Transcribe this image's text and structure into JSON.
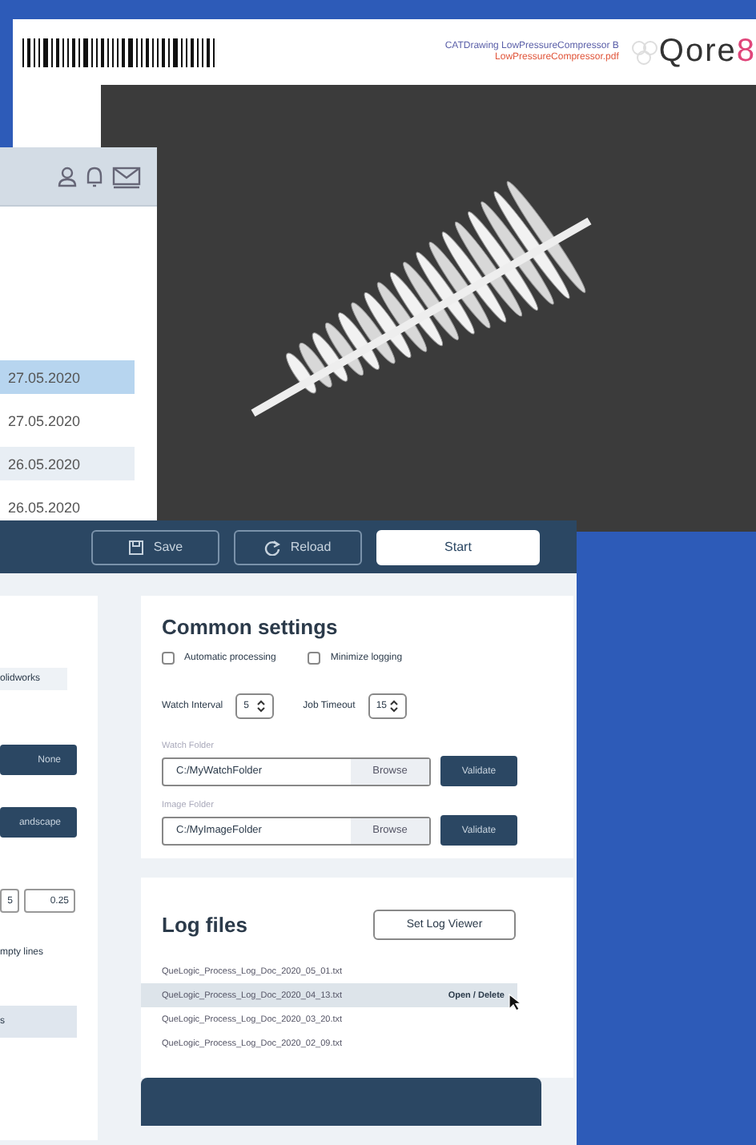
{
  "document_window": {
    "file_title": "CATDrawing LowPressureCompressor B",
    "file_name": "LowPressureCompressor.pdf",
    "logo_word": "Qore",
    "logo_digit": "8"
  },
  "list_window": {
    "rows": [
      {
        "date": "27.05.2020",
        "selected": true,
        "hovered": false
      },
      {
        "date": "27.05.2020",
        "selected": false,
        "hovered": false
      },
      {
        "date": "26.05.2020",
        "selected": false,
        "hovered": true
      },
      {
        "date": "26.05.2020",
        "selected": false,
        "hovered": false
      }
    ]
  },
  "settings_window": {
    "toolbar": [
      {
        "label": "Save",
        "kind": "outline"
      },
      {
        "label": "Reload",
        "kind": "outline"
      },
      {
        "label": "Start",
        "kind": "primary"
      }
    ],
    "left_panel": [
      {
        "kind": "chip",
        "text": "olidworks"
      },
      {
        "kind": "button",
        "text": "None"
      },
      {
        "kind": "button",
        "text": "andscape"
      },
      {
        "kind": "inputs",
        "values": [
          "5",
          "0.25"
        ]
      },
      {
        "kind": "text",
        "text": "mpty lines"
      },
      {
        "kind": "bar",
        "text": "s"
      }
    ],
    "common_settings": {
      "title": "Common settings",
      "checkboxes": [
        {
          "label": "Automatic processing",
          "checked": false
        },
        {
          "label": "Minimize logging",
          "checked": false
        }
      ],
      "spinners": [
        {
          "label": "Watch Interval",
          "value": "5"
        },
        {
          "label": "Job Timeout",
          "value": "15"
        }
      ],
      "folders": [
        {
          "label": "Watch Folder",
          "value": "C:/MyWatchFolder",
          "browse": "Browse",
          "validate": "Validate"
        },
        {
          "label": "Image Folder",
          "value": "C:/MyImageFolder",
          "browse": "Browse",
          "validate": "Validate"
        }
      ]
    },
    "log_files": {
      "title": "Log files",
      "button": "Set Log Viewer",
      "files": [
        {
          "name": "QueLogic_Process_Log_Doc_2020_05_01.txt",
          "selected": false
        },
        {
          "name": "QueLogic_Process_Log_Doc_2020_04_13.txt",
          "selected": true,
          "action": "Open / Delete"
        },
        {
          "name": "QueLogic_Process_Log_Doc_2020_03_20.txt",
          "selected": false
        },
        {
          "name": "QueLogic_Process_Log_Doc_2020_02_09.txt",
          "selected": false
        }
      ]
    }
  }
}
